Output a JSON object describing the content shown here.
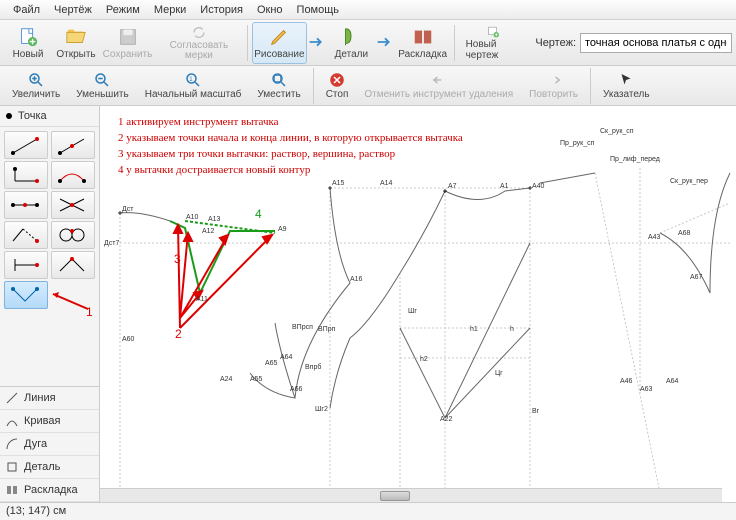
{
  "menu": {
    "items": [
      "Файл",
      "Чертёж",
      "Режим",
      "Мерки",
      "История",
      "Окно",
      "Помощь"
    ]
  },
  "toolbar1": {
    "new": "Новый",
    "open": "Открыть",
    "save": "Сохранить",
    "sync": "Согласовать мерки",
    "draw": "Рисование",
    "details": "Детали",
    "layout": "Раскладка",
    "newdraw": "Новый чертеж",
    "drawing_lbl": "Чертеж:",
    "drawing_val": "точная основа платья с одношовным рука"
  },
  "toolbar2": {
    "zoomin": "Увеличить",
    "zoomout": "Уменьшить",
    "zoomfit": "Начальный масштаб",
    "fit": "Уместить",
    "stop": "Стоп",
    "undo": "Отменить инструмент удаления",
    "redo": "Повторить",
    "pointer": "Указатель"
  },
  "tools_head": "Точка",
  "red_callouts": {
    "c1": "1",
    "c2": "2"
  },
  "modes": {
    "line": "Линия",
    "curve": "Кривая",
    "arc": "Дуга",
    "detail": "Деталь",
    "layout": "Раскладка"
  },
  "instructions": [
    "1 активируем инструмент вытачка",
    "2 указываем точки начала и конца линии, в которую открывается вытачка",
    "3 указываем три точки вытачки: раствор, вершина, раствор",
    "4 у вытачки достраивается новый контур"
  ],
  "steps": {
    "s3": "3",
    "s4": "4",
    "s2": "2"
  },
  "labels": {
    "dst": "Дст",
    "dst7": "Дст7",
    "a60": "А60",
    "a24": "А24",
    "a10": "А10",
    "a12": "А12",
    "a13": "А13",
    "a9": "А9",
    "a11": "А11",
    "a55": "А55",
    "a65": "А65",
    "a64": "А64",
    "a66": "А66",
    "vprsp": "ВПрсп",
    "vprp": "ВПрп",
    "vprb": "Впрб",
    "a15": "А15",
    "a14": "А14",
    "a7": "А7",
    "a1": "А1",
    "a40": "А40",
    "a16": "А16",
    "shg": "Шг",
    "shg2": "Шг2",
    "h1": "h1",
    "h2": "h2",
    "h": "h",
    "cg": "Цг",
    "a22": "А22",
    "bg": "Вг",
    "pr_ruk": "Пр_рук_сп",
    "sk_ruk": "Ск_рук_сп",
    "pr_lif": "Пр_лиф_перед",
    "sk_ruk_per": "Ск_рук_пер",
    "a43": "А43",
    "a68": "А68",
    "a67": "А67",
    "a46": "А46",
    "a63": "А63",
    "a64b": "А64"
  },
  "status": "(13; 147) см"
}
